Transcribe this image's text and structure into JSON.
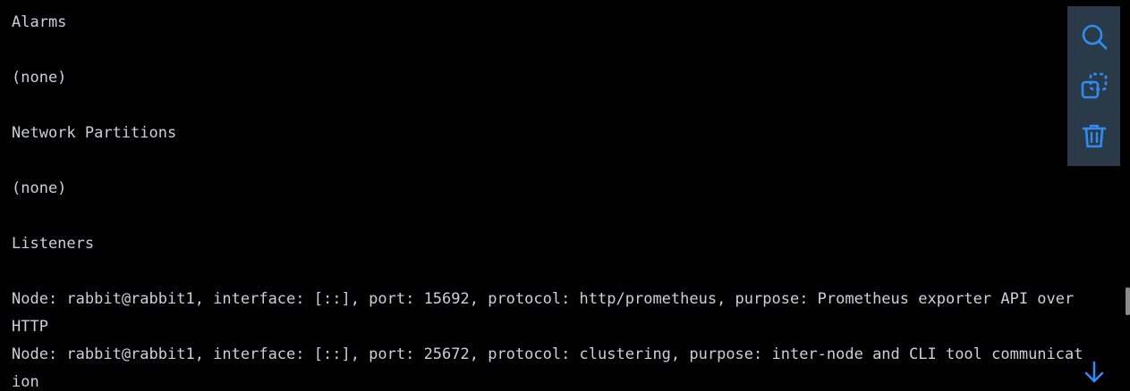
{
  "output": {
    "lines": [
      "Alarms",
      "",
      "(none)",
      "",
      "Network Partitions",
      "",
      "(none)",
      "",
      "Listeners",
      "",
      "Node: rabbit@rabbit1, interface: [::], port: 15692, protocol: http/prometheus, purpose: Prometheus exporter API over",
      "HTTP",
      "Node: rabbit@rabbit1, interface: [::], port: 25672, protocol: clustering, purpose: inter-node and CLI tool communicat",
      "ion"
    ]
  },
  "toolbar": {
    "buttons": [
      {
        "icon": "search-icon"
      },
      {
        "icon": "copy-icon"
      },
      {
        "icon": "trash-icon"
      }
    ]
  },
  "colors": {
    "background": "#000000",
    "text": "#c9d1d9",
    "toolbar_bg": "#2b3a48",
    "accent": "#2f8cf6"
  }
}
